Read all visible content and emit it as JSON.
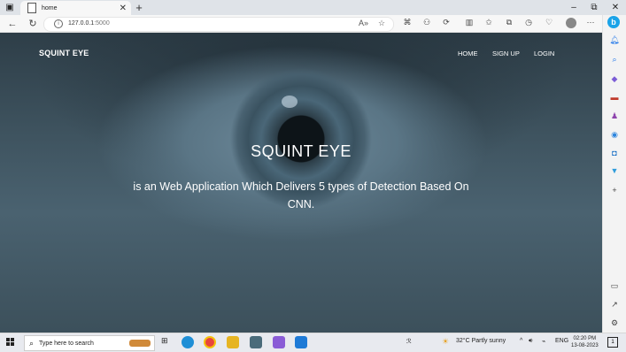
{
  "browser": {
    "tab_title": "home",
    "tab_close": "✕",
    "new_tab": "+",
    "url_host": "127.0.0.1",
    "url_port": ":5000",
    "window_controls": [
      "–",
      "⧉",
      "✕"
    ]
  },
  "site": {
    "brand": "SQUINT EYE",
    "nav": [
      "HOME",
      "SIGN UP",
      "LOGIN"
    ],
    "hero_title": "SQUINT EYE",
    "hero_subtitle": "is an Web Application Which Delivers 5 types of Detection Based On CNN."
  },
  "taskbar": {
    "search_placeholder": "Type here to search",
    "weather": "32°C  Partly sunny",
    "language": "ENG",
    "time": "02:20 PM",
    "date": "13-08-2023",
    "notification_count": "1"
  },
  "colors": {
    "bing": "#1aa3e8",
    "edge": "#1f8fd6",
    "chrome": "#e8453c",
    "vscode": "#1e7ad6"
  }
}
